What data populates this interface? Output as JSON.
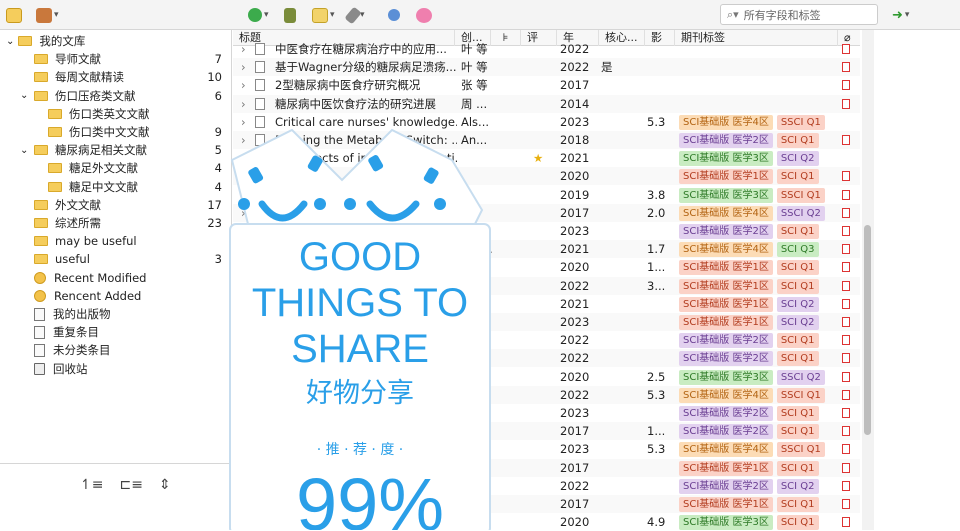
{
  "toolbar": {
    "search_placeholder": "所有字段和标签"
  },
  "sidebar": {
    "items": [
      {
        "label": "我的文库",
        "count": "",
        "level": 0,
        "type": "root"
      },
      {
        "label": "导师文献",
        "count": "7",
        "level": 1,
        "type": "folder"
      },
      {
        "label": "每周文献精读",
        "count": "10",
        "level": 1,
        "type": "folder"
      },
      {
        "label": "伤口压疮类文献",
        "count": "6",
        "level": 1,
        "type": "folder"
      },
      {
        "label": "伤口类英文文献",
        "count": "",
        "level": 2,
        "type": "folder"
      },
      {
        "label": "伤口类中文文献",
        "count": "9",
        "level": 2,
        "type": "folder"
      },
      {
        "label": "糖尿病足相关文献",
        "count": "5",
        "level": 1,
        "type": "folder"
      },
      {
        "label": "糖足外文文献",
        "count": "4",
        "level": 2,
        "type": "folder"
      },
      {
        "label": "糖足中文文献",
        "count": "4",
        "level": 2,
        "type": "folder"
      },
      {
        "label": "外文文献",
        "count": "17",
        "level": 1,
        "type": "folder"
      },
      {
        "label": "综述所需",
        "count": "23",
        "level": 1,
        "type": "folder"
      },
      {
        "label": "may be useful",
        "count": "",
        "level": 1,
        "type": "folder"
      },
      {
        "label": "useful",
        "count": "3",
        "level": 1,
        "type": "folder"
      },
      {
        "label": "Recent Modified",
        "count": "",
        "level": 1,
        "type": "clock"
      },
      {
        "label": "Rencent Added",
        "count": "",
        "level": 1,
        "type": "clock"
      },
      {
        "label": "我的出版物",
        "count": "",
        "level": 1,
        "type": "doc"
      },
      {
        "label": "重复条目",
        "count": "",
        "level": 1,
        "type": "doc"
      },
      {
        "label": "未分类条目",
        "count": "",
        "level": 1,
        "type": "doc"
      },
      {
        "label": "回收站",
        "count": "",
        "level": 1,
        "type": "trash"
      }
    ]
  },
  "columns": {
    "title": "标题",
    "creator": "创...",
    "year": "年",
    "core": "核心...",
    "impact": "影",
    "tags": "期刊标签",
    "rating": "评"
  },
  "rows": [
    {
      "title": "中医食疗在糖尿病治疗中的应用...",
      "creator": "叶 等",
      "year": "2022",
      "core": "",
      "impact": "",
      "tags": []
    },
    {
      "title": "基于Wagner分级的糖尿病足溃疡...",
      "creator": "叶 等",
      "year": "2022",
      "core": "是",
      "impact": "",
      "tags": []
    },
    {
      "title": "2型糖尿病中医食疗研究概况",
      "creator": "张 等",
      "year": "2017",
      "core": "",
      "impact": "",
      "tags": []
    },
    {
      "title": "糖尿病中医饮食疗法的研究进展",
      "creator": "周 ...",
      "year": "2014",
      "core": "",
      "impact": "",
      "tags": []
    },
    {
      "title": "Critical care nurses' knowledge...",
      "creator": "Als...",
      "year": "2023",
      "core": "",
      "impact": "5.3",
      "tags": [
        "SCI基础版 医学4区",
        "SSCI Q1"
      ]
    },
    {
      "title": "Flipping the Metabolic Switch: ...",
      "creator": "An...",
      "year": "2018",
      "core": "",
      "impact": "",
      "tags": [
        "SCI基础版 医学2区",
        "SCI Q1"
      ]
    },
    {
      "title": "The effects of intermittent fasti...",
      "creator": "",
      "year": "2021",
      "core": "",
      "impact": "",
      "tags": [
        "SCI基础版 医学3区",
        "SCI Q2"
      ],
      "star": true
    },
    {
      "title": "",
      "creator": "",
      "year": "2020",
      "core": "",
      "impact": "",
      "tags": [
        "SCI基础版 医学1区",
        "SCI Q1"
      ]
    },
    {
      "title": "",
      "creator": "",
      "year": "2019",
      "core": "",
      "impact": "3.8",
      "tags": [
        "SCI基础版 医学3区",
        "SSCI Q1"
      ]
    },
    {
      "title": "",
      "creator": "",
      "year": "2017",
      "core": "",
      "impact": "2.0",
      "tags": [
        "SCI基础版 医学4区",
        "SSCI Q2"
      ]
    },
    {
      "title": "",
      "creator": "Ch...",
      "year": "2023",
      "core": "",
      "impact": "",
      "tags": [
        "SCI基础版 医学2区",
        "SCI Q1"
      ]
    },
    {
      "title": "",
      "creator": "Elef...",
      "year": "2021",
      "core": "",
      "impact": "1.7",
      "tags": [
        "SCI基础版 医学4区",
        "SCI Q3"
      ]
    },
    {
      "title": "",
      "creator": "Haj...",
      "year": "2020",
      "core": "",
      "impact": "1...",
      "tags": [
        "SCI基础版 医学1区",
        "SCI Q1"
      ]
    },
    {
      "title": "",
      "creator": "",
      "year": "2022",
      "core": "",
      "impact": "3...",
      "tags": [
        "SCI基础版 医学1区",
        "SCI Q1"
      ]
    },
    {
      "title": "",
      "creator": "",
      "year": "2021",
      "core": "",
      "impact": "",
      "tags": [
        "SCI基础版 医学1区",
        "SCI Q2"
      ]
    },
    {
      "title": "",
      "creator": "",
      "year": "2023",
      "core": "",
      "impact": "",
      "tags": [
        "SCI基础版 医学1区",
        "SCI Q2"
      ]
    },
    {
      "title": "",
      "creator": "er...",
      "year": "2022",
      "core": "",
      "impact": "",
      "tags": [
        "SCI基础版 医学2区",
        "SCI Q1"
      ]
    },
    {
      "title": "",
      "creator": "",
      "year": "2022",
      "core": "",
      "impact": "",
      "tags": [
        "SCI基础版 医学2区",
        "SCI Q1"
      ]
    },
    {
      "title": "",
      "creator": "ot...",
      "year": "2020",
      "core": "",
      "impact": "2.5",
      "tags": [
        "SCI基础版 医学3区",
        "SSCI Q2"
      ]
    },
    {
      "title": "",
      "creator": "",
      "year": "2022",
      "core": "",
      "impact": "5.3",
      "tags": [
        "SCI基础版 医学4区",
        "SSCI Q1"
      ]
    },
    {
      "title": "",
      "creator": "",
      "year": "2023",
      "core": "",
      "impact": "",
      "tags": [
        "SCI基础版 医学2区",
        "SCI Q1"
      ]
    },
    {
      "title": "",
      "creator": "",
      "year": "2017",
      "core": "",
      "impact": "1...",
      "tags": [
        "SCI基础版 医学2区",
        "SCI Q1"
      ]
    },
    {
      "title": "",
      "creator": "",
      "year": "2023",
      "core": "",
      "impact": "5.3",
      "tags": [
        "SCI基础版 医学4区",
        "SSCI Q1"
      ]
    },
    {
      "title": "",
      "creator": "",
      "year": "2017",
      "core": "",
      "impact": "",
      "tags": [
        "SCI基础版 医学1区",
        "SCI Q1"
      ]
    },
    {
      "title": "",
      "creator": "",
      "year": "2022",
      "core": "",
      "impact": "",
      "tags": [
        "SCI基础版 医学2区",
        "SCI Q2"
      ]
    },
    {
      "title": "",
      "creator": "",
      "year": "2017",
      "core": "",
      "impact": "",
      "tags": [
        "SCI基础版 医学1区",
        "SCI Q1"
      ]
    },
    {
      "title": "",
      "creator": "",
      "year": "2020",
      "core": "",
      "impact": "4.9",
      "tags": [
        "SCI基础版 医学3区",
        "SCI Q1"
      ]
    }
  ],
  "overlay": {
    "line1": "GOOD",
    "line2": "THINGS TO",
    "line3": "SHARE",
    "line4": "好物分享",
    "line5": "· 推 · 荐 · 度 ·",
    "line6": "99%"
  }
}
